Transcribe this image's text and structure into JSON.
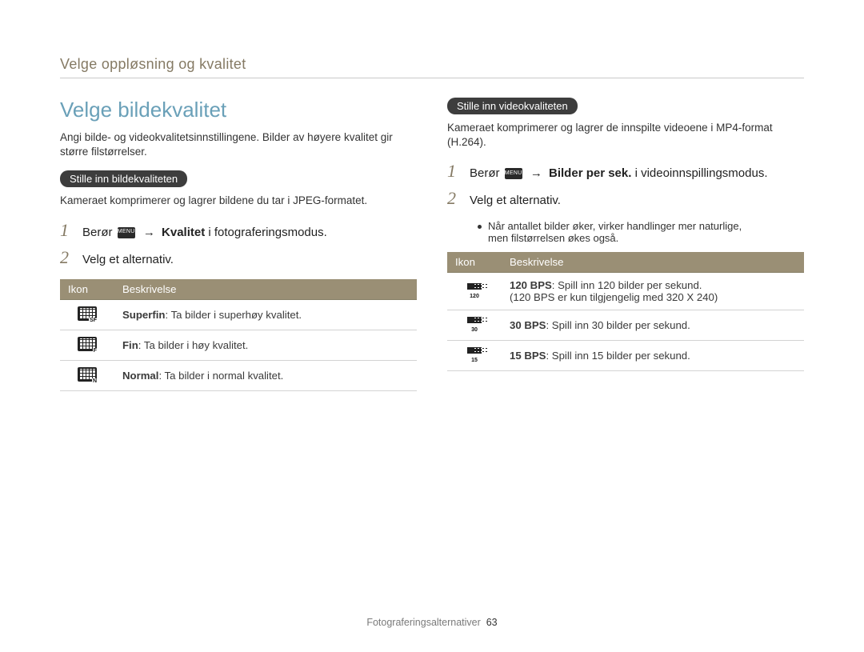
{
  "header": {
    "breadcrumb": "Velge oppløsning og kvalitet"
  },
  "left": {
    "title": "Velge bildekvalitet",
    "intro": "Angi bilde- og videokvalitetsinnstillingene. Bilder av høyere kvalitet gir større filstørrelser.",
    "pill": "Stille inn bildekvaliteten",
    "desc": "Kameraet komprimerer og lagrer bildene du tar i JPEG-formatet.",
    "step1_pre": "Berør ",
    "step1_menu": "MENU",
    "step1_arrow": "→",
    "step1_bold": "Kvalitet",
    "step1_post": " i fotograferingsmodus.",
    "step2": "Velg et alternativ.",
    "table": {
      "h1": "Ikon",
      "h2": "Beskrivelse",
      "rows": [
        {
          "icon_sub": "SF",
          "bold": "Superfin",
          "rest": ": Ta bilder i superhøy kvalitet."
        },
        {
          "icon_sub": "F",
          "bold": "Fin",
          "rest": ": Ta bilder i høy kvalitet."
        },
        {
          "icon_sub": "N",
          "bold": "Normal",
          "rest": ": Ta bilder i normal kvalitet."
        }
      ]
    }
  },
  "right": {
    "pill": "Stille inn videokvaliteten",
    "desc": "Kameraet komprimerer og lagrer de innspilte videoene i MP4-format (H.264).",
    "step1_pre": "Berør ",
    "step1_menu": "MENU",
    "step1_arrow": "→",
    "step1_bold": "Bilder per sek.",
    "step1_post": " i videoinnspillingsmodus.",
    "step2": "Velg et alternativ.",
    "note1": "Når antallet bilder øker, virker handlinger mer naturlige,",
    "note2": "men filstørrelsen økes også.",
    "table": {
      "h1": "Ikon",
      "h2": "Beskrivelse",
      "rows": [
        {
          "icon_sub": "120",
          "bold": "120 BPS",
          "rest": ": Spill inn 120 bilder per sekund.",
          "extra": "(120 BPS er kun tilgjengelig med 320 X 240)"
        },
        {
          "icon_sub": "30",
          "bold": "30 BPS",
          "rest": ": Spill inn 30 bilder per sekund."
        },
        {
          "icon_sub": "15",
          "bold": "15 BPS",
          "rest": ": Spill inn 15 bilder per sekund."
        }
      ]
    }
  },
  "footer": {
    "section": "Fotograferingsalternativer",
    "page": "63"
  }
}
